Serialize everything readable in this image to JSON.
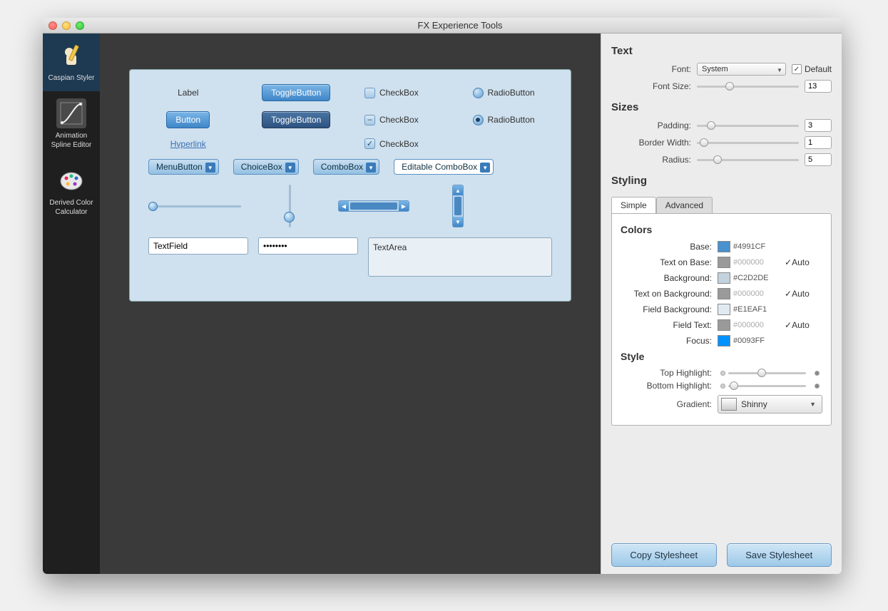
{
  "window": {
    "title": "FX Experience Tools"
  },
  "tools": [
    {
      "label": "Caspian Styler",
      "active": true
    },
    {
      "label": "Animation Spline Editor",
      "active": false
    },
    {
      "label": "Derived Color Calculator",
      "active": false
    }
  ],
  "preview": {
    "label": "Label",
    "button": "Button",
    "toggle1": "ToggleButton",
    "toggle2": "ToggleButton",
    "hyperlink": "Hyperlink",
    "checkbox1": "CheckBox",
    "checkbox2": "CheckBox",
    "checkbox3": "CheckBox",
    "radio1": "RadioButton",
    "radio2": "RadioButton",
    "menubutton": "MenuButton",
    "choicebox": "ChoiceBox",
    "combobox": "ComboBox",
    "editable_combo": "Editable ComboBox",
    "textfield": "TextField",
    "password": "••••••••",
    "textarea": "TextArea"
  },
  "panel": {
    "text_heading": "Text",
    "font_label": "Font:",
    "font_value": "System",
    "default_label": "Default",
    "fontsize_label": "Font Size:",
    "fontsize_value": "13",
    "sizes_heading": "Sizes",
    "padding_label": "Padding:",
    "padding_value": "3",
    "borderwidth_label": "Border Width:",
    "borderwidth_value": "1",
    "radius_label": "Radius:",
    "radius_value": "5",
    "styling_heading": "Styling",
    "tab_simple": "Simple",
    "tab_advanced": "Advanced",
    "colors_heading": "Colors",
    "style_heading": "Style",
    "base_label": "Base:",
    "base_value": "#4991CF",
    "base_color": "#4991CF",
    "textonbase_label": "Text on Base:",
    "textonbase_value": "#000000",
    "textonbase_color": "#9a9a9a",
    "auto_label": "Auto",
    "background_label": "Background:",
    "background_value": "#C2D2DE",
    "background_color": "#C2D2DE",
    "textonbg_label": "Text on Background:",
    "textonbg_value": "#000000",
    "textonbg_color": "#9a9a9a",
    "fieldbg_label": "Field Background:",
    "fieldbg_value": "#E1EAF1",
    "fieldbg_color": "#E1EAF1",
    "fieldtext_label": "Field Text:",
    "fieldtext_value": "#000000",
    "fieldtext_color": "#9a9a9a",
    "focus_label": "Focus:",
    "focus_value": "#0093FF",
    "focus_color": "#0093FF",
    "tophl_label": "Top Highlight:",
    "bothl_label": "Bottom Highlight:",
    "gradient_label": "Gradient:",
    "gradient_value": "Shinny",
    "copy_btn": "Copy Stylesheet",
    "save_btn": "Save Stylesheet"
  }
}
